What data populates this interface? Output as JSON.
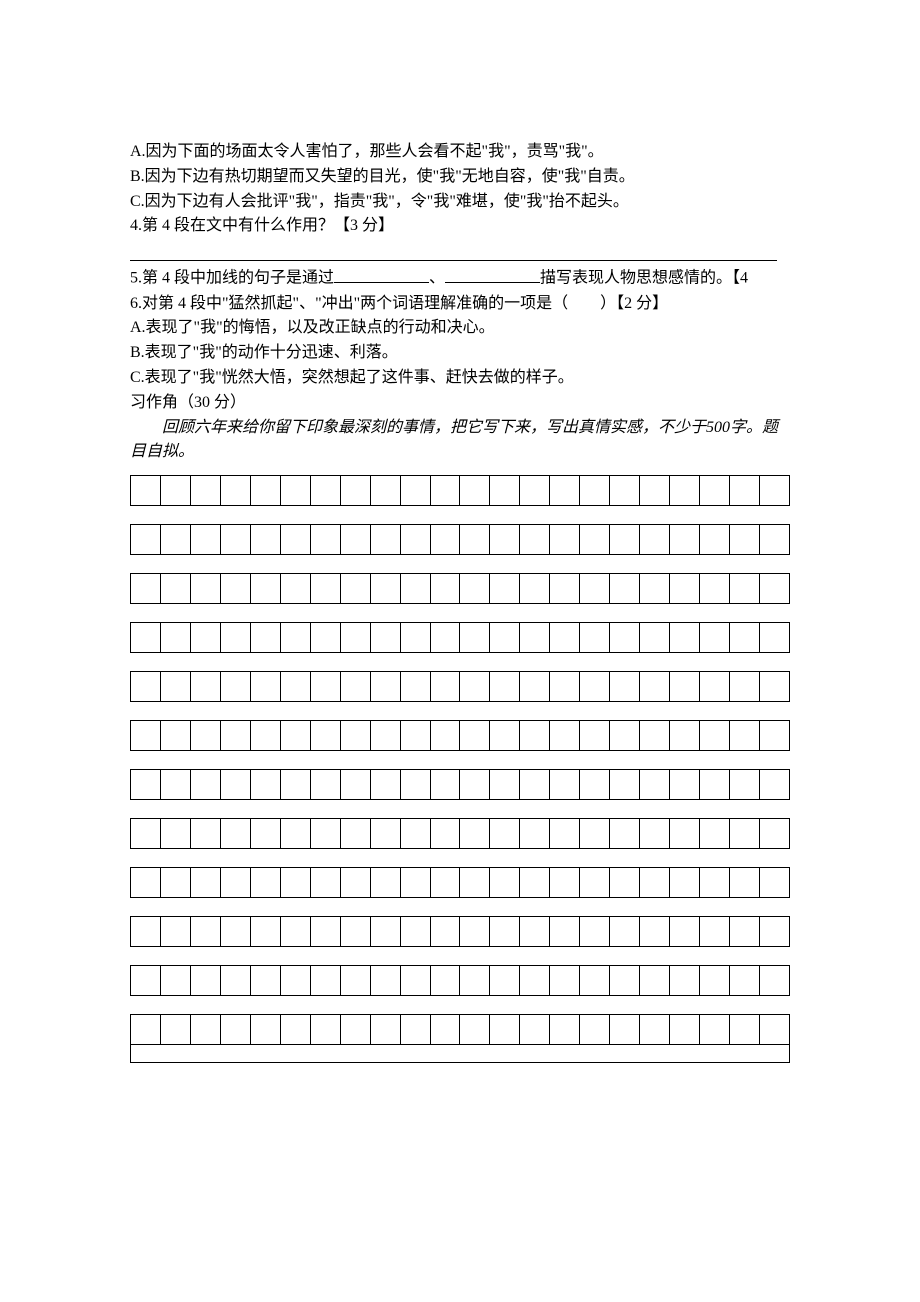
{
  "lines": {
    "optA": "A.因为下面的场面太令人害怕了，那些人会看不起\"我\"，责骂\"我\"。",
    "optB": "B.因为下边有热切期望而又失望的目光，使\"我\"无地自容，使\"我\"自责。",
    "optC": "C.因为下边有人会批评\"我\"，指责\"我\"，令\"我\"难堪，使\"我\"抬不起头。",
    "q4": "4.第 4 段在文中有什么作用？【3 分】",
    "q5_pre": "5.第 4 段中加线的句子是通过",
    "q5_sep": "、",
    "q5_post": "描写表现人物思想感情的。【4",
    "q6": "6.对第 4 段中\"猛然抓起\"、\"冲出\"两个词语理解准确的一项是（　　）【2 分】",
    "q6A": "A.表现了\"我\"的悔悟，以及改正缺点的行动和决心。",
    "q6B": "B.表现了\"我\"的动作十分迅速、利落。",
    "q6C": "C.表现了\"我\"恍然大悟，突然想起了这件事、赶快去做的样子。",
    "section": "习作角（30 分）",
    "prompt": "回顾六年来给你留下印象最深刻的事情，把它写下来，写出真情实感，不少于500字。题目自拟。"
  },
  "grid": {
    "rows": 12,
    "cols": 22
  }
}
